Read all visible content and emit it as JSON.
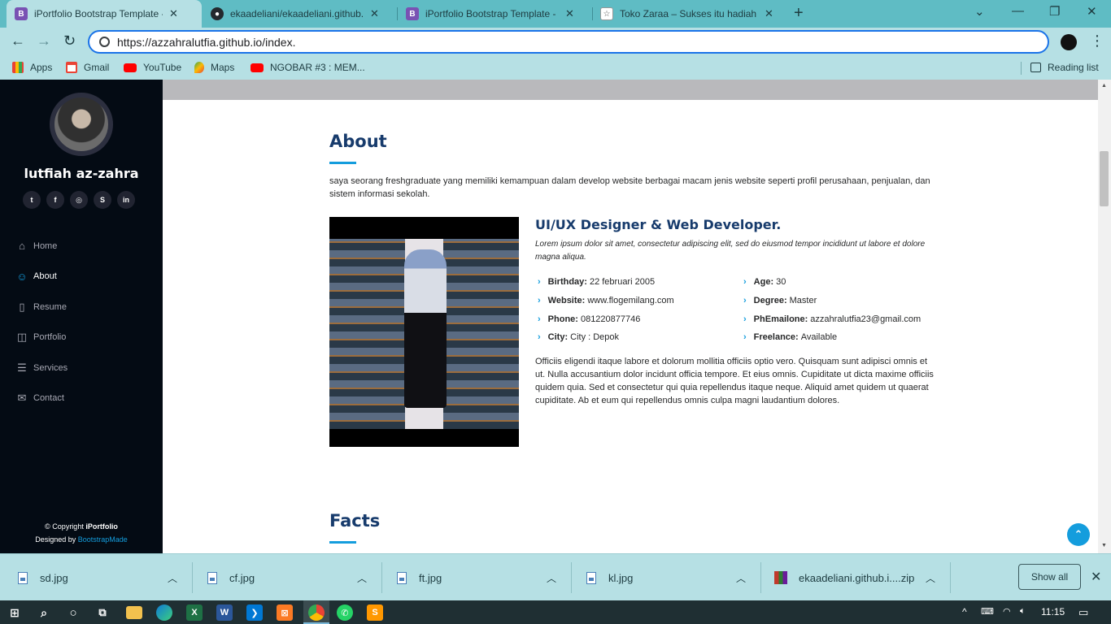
{
  "browser": {
    "tabs": [
      {
        "title": "iPortfolio Bootstrap Template - In",
        "favicon": "bootstrap-icon",
        "active": true
      },
      {
        "title": "ekaadeliani/ekaadeliani.github.io",
        "favicon": "github-icon",
        "active": false
      },
      {
        "title": "iPortfolio Bootstrap Template - In",
        "favicon": "bootstrap-icon",
        "active": false
      },
      {
        "title": "Toko Zaraa – Sukses itu hadiah ba",
        "favicon": "site-icon",
        "active": false
      }
    ],
    "url": "https://azzahralutfia.github.io/index.",
    "bookmarks": [
      {
        "label": "Apps",
        "icon": "apps-grid-icon"
      },
      {
        "label": "Gmail",
        "icon": "gmail-icon"
      },
      {
        "label": "YouTube",
        "icon": "youtube-icon"
      },
      {
        "label": "Maps",
        "icon": "maps-icon"
      },
      {
        "label": "NGOBAR #3 : MEM...",
        "icon": "youtube-icon"
      }
    ],
    "reading_list": "Reading list"
  },
  "sidebar": {
    "name": "lutfiah az-zahra",
    "socials": [
      "twitter",
      "facebook",
      "instagram",
      "skype",
      "linkedin"
    ],
    "menu": [
      {
        "label": "Home",
        "icon": "home-icon",
        "active": false
      },
      {
        "label": "About",
        "icon": "person-icon",
        "active": true
      },
      {
        "label": "Resume",
        "icon": "file-icon",
        "active": false
      },
      {
        "label": "Portfolio",
        "icon": "book-icon",
        "active": false
      },
      {
        "label": "Services",
        "icon": "server-icon",
        "active": false
      },
      {
        "label": "Contact",
        "icon": "envelope-icon",
        "active": false
      }
    ],
    "copyright_prefix": "© Copyright ",
    "copyright_brand": "iPortfolio",
    "designed_by": "Designed by ",
    "designed_by_link": "BootstrapMade"
  },
  "about": {
    "title": "About",
    "intro": "saya seorang freshgraduate yang memiliki kemampuan dalam develop website berbagai macam jenis website seperti profil perusahaan, penjualan, dan sistem informasi sekolah.",
    "role": "UI/UX Designer & Web Developer.",
    "lorem": "Lorem ipsum dolor sit amet, consectetur adipiscing elit, sed do eiusmod tempor incididunt ut labore et dolore magna aliqua.",
    "info_left": [
      {
        "label": "Birthday:",
        "value": "22 februari 2005"
      },
      {
        "label": "Website:",
        "value": "www.flogemilang.com"
      },
      {
        "label": "Phone:",
        "value": "081220877746"
      },
      {
        "label": "City:",
        "value": "City : Depok"
      }
    ],
    "info_right": [
      {
        "label": "Age:",
        "value": "30"
      },
      {
        "label": "Degree:",
        "value": "Master"
      },
      {
        "label": "PhEmailone:",
        "value": "azzahralutfia23@gmail.com"
      },
      {
        "label": "Freelance:",
        "value": "Available"
      }
    ],
    "paragraph": "Officiis eligendi itaque labore et dolorum mollitia officiis optio vero. Quisquam sunt adipisci omnis et ut. Nulla accusantium dolor incidunt officia tempore. Et eius omnis. Cupiditate ut dicta maxime officiis quidem quia. Sed et consectetur qui quia repellendus itaque neque. Aliquid amet quidem ut quaerat cupiditate. Ab et eum qui repellendus omnis culpa magni laudantium dolores."
  },
  "facts": {
    "title": "Facts"
  },
  "downloads": {
    "items": [
      {
        "name": "sd.jpg",
        "type": "image"
      },
      {
        "name": "cf.jpg",
        "type": "image"
      },
      {
        "name": "ft.jpg",
        "type": "image"
      },
      {
        "name": "kl.jpg",
        "type": "image"
      },
      {
        "name": "ekaadeliani.github.i....zip",
        "type": "zip"
      }
    ],
    "show_all": "Show all"
  },
  "taskbar": {
    "time": "11:15"
  },
  "colors": {
    "accent": "#149ddd",
    "heading": "#173b6c",
    "sidebar_bg": "#040b14",
    "chrome_bg": "#b6e0e4",
    "tabstrip_bg": "#5fbcc4"
  }
}
